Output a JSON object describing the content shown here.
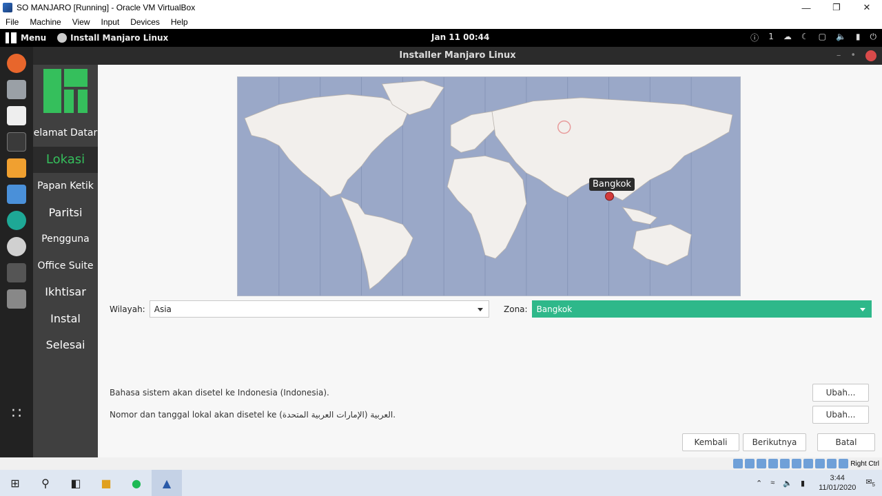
{
  "host": {
    "window_title": "SO MANJARO [Running] - Oracle VM VirtualBox",
    "menu": [
      "File",
      "Machine",
      "View",
      "Input",
      "Devices",
      "Help"
    ],
    "window_controls": [
      "minimize-icon",
      "restore-icon",
      "close-icon"
    ],
    "status_right": "Right Ctrl",
    "taskbar": {
      "time": "3:44",
      "date": "11/01/2020",
      "notif_count": "5"
    }
  },
  "guest_panel": {
    "menu_label": "Menu",
    "task_label": "Install Manjaro Linux",
    "clock": "Jan 11  00:44",
    "tray_count": "1"
  },
  "installer": {
    "title": "Installer Manjaro Linux",
    "steps": [
      {
        "label": "elamat Datar"
      },
      {
        "label": "Lokasi"
      },
      {
        "label": "Papan Ketik"
      },
      {
        "label": "Paritsi"
      },
      {
        "label": "Pengguna"
      },
      {
        "label": "Office Suite"
      },
      {
        "label": "Ikhtisar"
      },
      {
        "label": "Instal"
      },
      {
        "label": "Selesai"
      }
    ],
    "map_pin_label": "Bangkok",
    "region_label": "Wilayah:",
    "region_value": "Asia",
    "zone_label": "Zona:",
    "zone_value": "Bangkok",
    "lang_info": "Bahasa sistem akan disetel ke Indonesia (Indonesia).",
    "locale_info": "Nomor dan tanggal lokal akan disetel ke العربية (الإمارات العربية المتحدة).",
    "change_label": "Ubah...",
    "back_label": "Kembali",
    "next_label": "Berikutnya",
    "cancel_label": "Batal"
  },
  "colors": {
    "accent_green": "#35bf5c",
    "zone_green": "#2eb88a",
    "map_ocean": "#9aa8c8",
    "map_land": "#f2efec"
  }
}
